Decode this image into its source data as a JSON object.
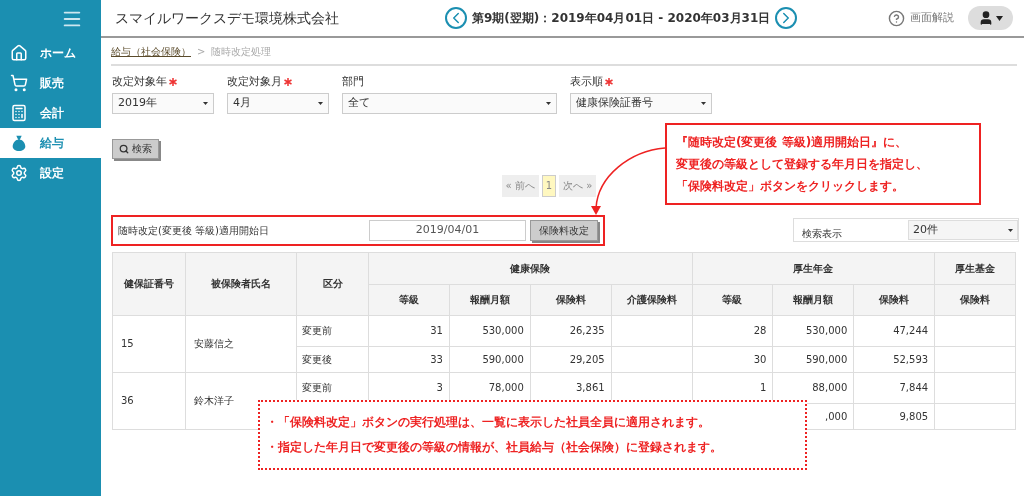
{
  "header": {
    "company": "スマイルワークスデモ環境株式会社",
    "period": "第9期(翌期)：2019年04月01日 - 2020年03月31日",
    "help": "画面解説"
  },
  "sidebar": {
    "items": [
      {
        "label": "ホーム",
        "kind": "home",
        "selected": false
      },
      {
        "label": "販売",
        "kind": "cart",
        "selected": false
      },
      {
        "label": "会計",
        "kind": "calc",
        "selected": false
      },
      {
        "label": "給与",
        "kind": "bag",
        "selected": true
      },
      {
        "label": "設定",
        "kind": "gear",
        "selected": false
      }
    ]
  },
  "breadcrumb": {
    "parent": "給与（社会保険）",
    "separator": ">",
    "current": "随時改定処理"
  },
  "filters": [
    {
      "label": "改定対象年",
      "required": true,
      "value": "2019年"
    },
    {
      "label": "改定対象月",
      "required": true,
      "value": "4月"
    },
    {
      "label": "部門",
      "required": false,
      "value": "全て"
    },
    {
      "label": "表示順",
      "required": true,
      "value": "健康保険証番号"
    }
  ],
  "search_button": "検索",
  "pagination": {
    "prev": "« 前へ",
    "pages": [
      {
        "label": "1",
        "selected": true
      }
    ],
    "next": "次へ »"
  },
  "apply_date": {
    "label": "随時改定(変更後 等級)適用開始日",
    "value": "2019/04/01",
    "button": "保険料改定"
  },
  "page_size": {
    "label": "検索表示",
    "value": "20件"
  },
  "table": {
    "columns": [
      "健保証番号",
      "被保険者氏名",
      "区分"
    ],
    "groups": [
      {
        "label": "健康保険",
        "columns": [
          "等級",
          "報酬月額",
          "保険料",
          "介護保険料"
        ]
      },
      {
        "label": "厚生年金",
        "columns": [
          "等級",
          "報酬月額",
          "保険料"
        ]
      },
      {
        "label": "厚生基金",
        "columns": [
          "保険料"
        ]
      }
    ],
    "rows": [
      {
        "number": "15",
        "name": "安藤信之",
        "lines": [
          {
            "kubun": "変更前",
            "cells": [
              "31",
              "530,000",
              "26,235",
              null,
              "28",
              "530,000",
              "47,244",
              null
            ]
          },
          {
            "kubun": "変更後",
            "cells": [
              "33",
              "590,000",
              "29,205",
              null,
              "30",
              "590,000",
              "52,593",
              null
            ]
          }
        ]
      },
      {
        "number": "36",
        "name": "鈴木洋子",
        "lines": [
          {
            "kubun": "変更前",
            "cells": [
              "3",
              "78,000",
              "3,861",
              null,
              "1",
              "88,000",
              "7,844",
              null
            ]
          },
          {
            "cells": [
              null,
              null,
              null,
              null,
              null,
              ",000",
              "9,805",
              null
            ]
          }
        ]
      }
    ]
  },
  "callout": {
    "lines": [
      "『随時改定(変更後 等級)適用開始日』に、",
      "変更後の等級として登録する年月日を指定し、",
      "「保険料改定」ボタンをクリックします。"
    ]
  },
  "note": {
    "lines": [
      "・「保険料改定」ボタンの実行処理は、一覧に表示した社員全員に適用されます。",
      "・指定した年月日で変更後の等級の情報が、社員給与（社会保険）に登録されます。"
    ]
  }
}
